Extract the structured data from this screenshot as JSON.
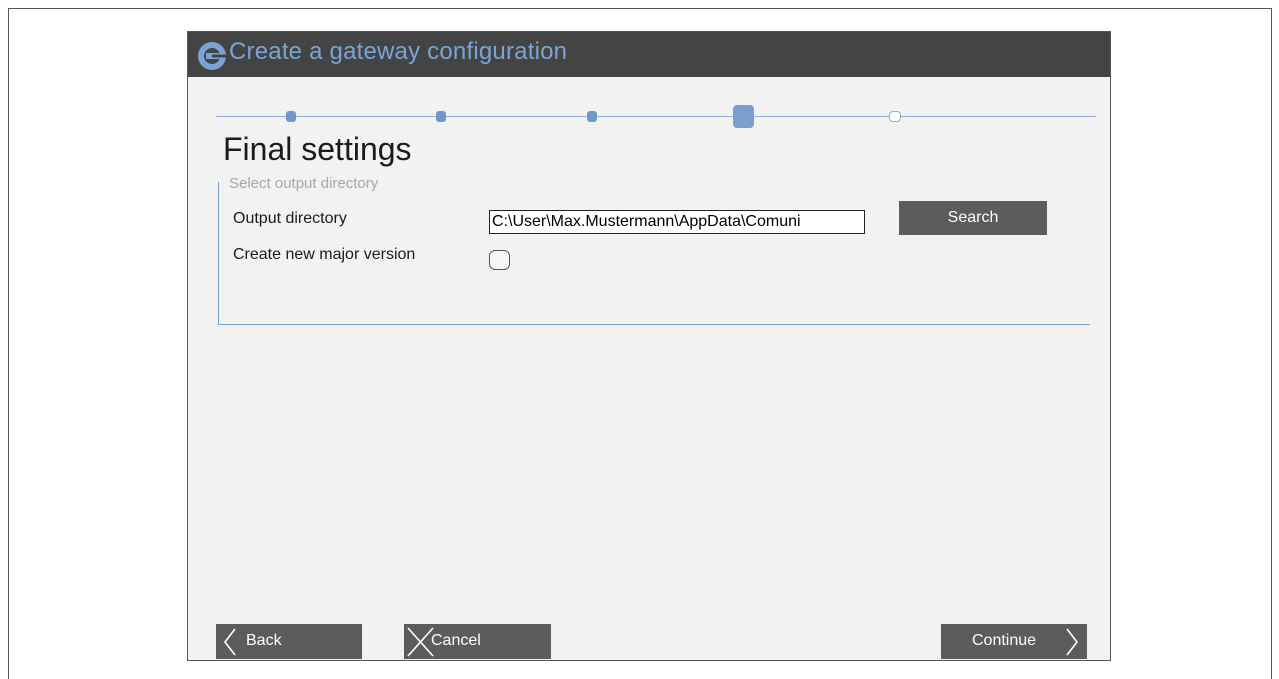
{
  "window": {
    "title": "Create a gateway configuration",
    "title_icon": "gateway-logo-icon",
    "accent_color": "#7ba4d6",
    "titlebar_color": "#444444"
  },
  "stepper": {
    "total_steps": 5,
    "current_step": 4,
    "completed_steps": 3
  },
  "page": {
    "heading": "Final settings"
  },
  "output_group": {
    "legend": "Select output directory",
    "output_directory_label": "Output directory",
    "output_directory_value": "C:\\User\\Max.Mustermann\\AppData\\Comuni",
    "search_label": "Search",
    "major_version_label": "Create new major version",
    "major_version_checked": false
  },
  "footer": {
    "back_label": "Back",
    "back_icon": "chevron-left-icon",
    "cancel_label": "Cancel",
    "cancel_icon": "close-icon",
    "continue_label": "Continue",
    "continue_icon": "chevron-right-icon"
  }
}
